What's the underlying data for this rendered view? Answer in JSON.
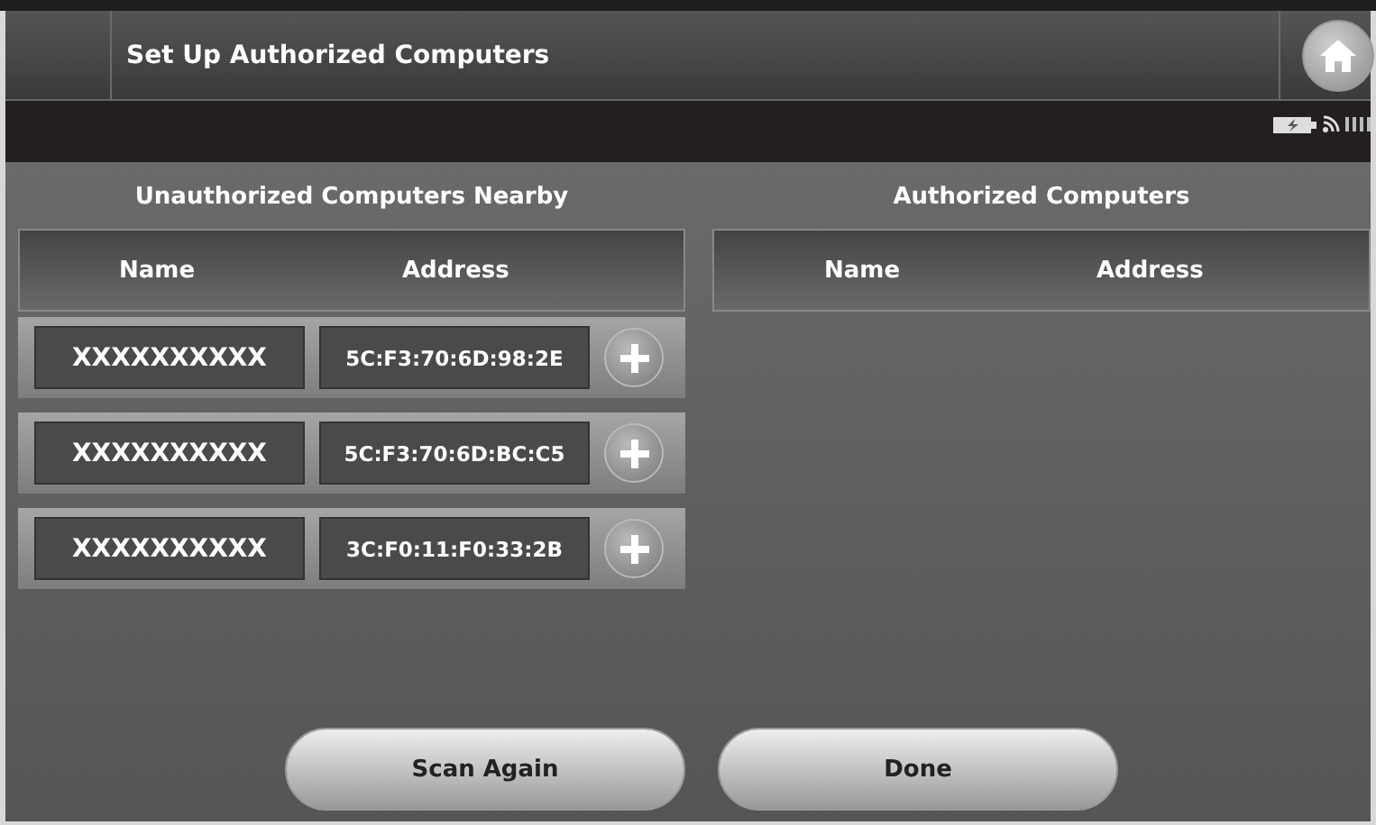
{
  "window": {
    "title": "Set Up Authorized Computers"
  },
  "unauthorized": {
    "title": "Unauthorized Computers Nearby",
    "columns": [
      "Name",
      "Address"
    ],
    "rows": [
      {
        "name": "XXXXXXXXXX",
        "address": "5C:F3:70:6D:98:2E"
      },
      {
        "name": "XXXXXXXXXX",
        "address": "5C:F3:70:6D:BC:C5"
      },
      {
        "name": "XXXXXXXXXX",
        "address": "3C:F0:11:F0:33:2B"
      }
    ]
  },
  "authorized": {
    "title": "Authorized Computers",
    "columns": [
      "Name",
      "Address"
    ]
  },
  "buttons": [
    "Scan Again",
    "Done"
  ]
}
